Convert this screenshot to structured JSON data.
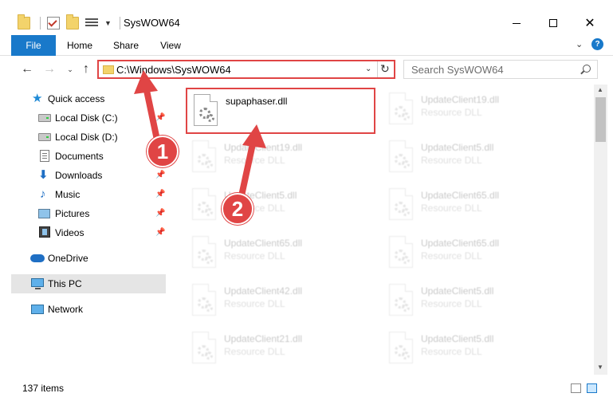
{
  "window": {
    "title": "SysWOW64",
    "minimize": "—",
    "close": "✕"
  },
  "ribbon": {
    "tabs": [
      "File",
      "Home",
      "Share",
      "View"
    ],
    "help": "?",
    "chevron": "⌄"
  },
  "nav": {
    "back": "←",
    "forward": "→",
    "recent": "⌄",
    "up": "↑",
    "address": "C:\\Windows\\SysWOW64",
    "address_dropdown": "⌄",
    "refresh": "↻",
    "search_placeholder": "Search SysWOW64"
  },
  "sidebar": {
    "items": [
      {
        "label": "Quick access",
        "icon": "star-icon"
      },
      {
        "label": "Local Disk (C:)",
        "icon": "drive-icon",
        "pinned": true
      },
      {
        "label": "Local Disk (D:)",
        "icon": "drive-icon"
      },
      {
        "label": "Documents",
        "icon": "documents-icon",
        "pinned": true
      },
      {
        "label": "Downloads",
        "icon": "downloads-icon",
        "pinned": true
      },
      {
        "label": "Music",
        "icon": "music-icon",
        "pinned": true
      },
      {
        "label": "Pictures",
        "icon": "pictures-icon",
        "pinned": true
      },
      {
        "label": "Videos",
        "icon": "videos-icon",
        "pinned": true
      },
      {
        "label": "OneDrive",
        "icon": "onedrive-icon"
      },
      {
        "label": "This PC",
        "icon": "this-pc-icon",
        "selected": true
      },
      {
        "label": "Network",
        "icon": "network-icon"
      }
    ],
    "pin_glyph": "📌"
  },
  "files": [
    {
      "name": "supaphaser.dll",
      "type": "",
      "highlighted": true
    },
    {
      "name": "UpdateClient19.dll",
      "type": "Resource DLL"
    },
    {
      "name": "UpdateClient19.dll",
      "type": "Resource DLL"
    },
    {
      "name": "UpdateClient5.dll",
      "type": "Resource DLL"
    },
    {
      "name": "UpdateClient5.dll",
      "type": "Resource DLL"
    },
    {
      "name": "UpdateClient65.dll",
      "type": "Resource DLL"
    },
    {
      "name": "UpdateClient65.dll",
      "type": "Resource DLL"
    },
    {
      "name": "UpdateClient65.dll",
      "type": "Resource DLL"
    },
    {
      "name": "UpdateClient42.dll",
      "type": "Resource DLL"
    },
    {
      "name": "UpdateClient5.dll",
      "type": "Resource DLL"
    },
    {
      "name": "UpdateClient21.dll",
      "type": "Resource DLL"
    },
    {
      "name": "UpdateClient5.dll",
      "type": "Resource DLL"
    }
  ],
  "status": {
    "item_count": "137 items"
  },
  "annotations": {
    "step1": "1",
    "step2": "2"
  },
  "colors": {
    "accent": "#1979ca",
    "highlight_red": "#e04545",
    "selection": "#cce8ff"
  }
}
